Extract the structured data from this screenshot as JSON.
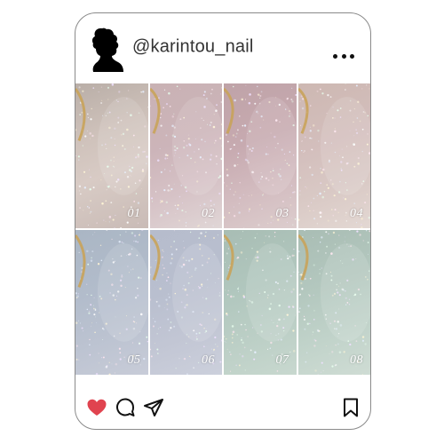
{
  "post": {
    "username": "@karintou_nail",
    "tiles": [
      {
        "label": "01"
      },
      {
        "label": "02"
      },
      {
        "label": "03"
      },
      {
        "label": "04"
      },
      {
        "label": "05"
      },
      {
        "label": "06"
      },
      {
        "label": "07"
      },
      {
        "label": "08"
      }
    ]
  },
  "icons": {
    "avatar": "woman-silhouette-icon",
    "more": "more-options-icon",
    "like": "heart-icon",
    "comment": "comment-bubble-icon",
    "share": "send-icon",
    "save": "bookmark-icon"
  },
  "colors": {
    "like": "#e0434f",
    "frame": "#8a8a8a"
  }
}
